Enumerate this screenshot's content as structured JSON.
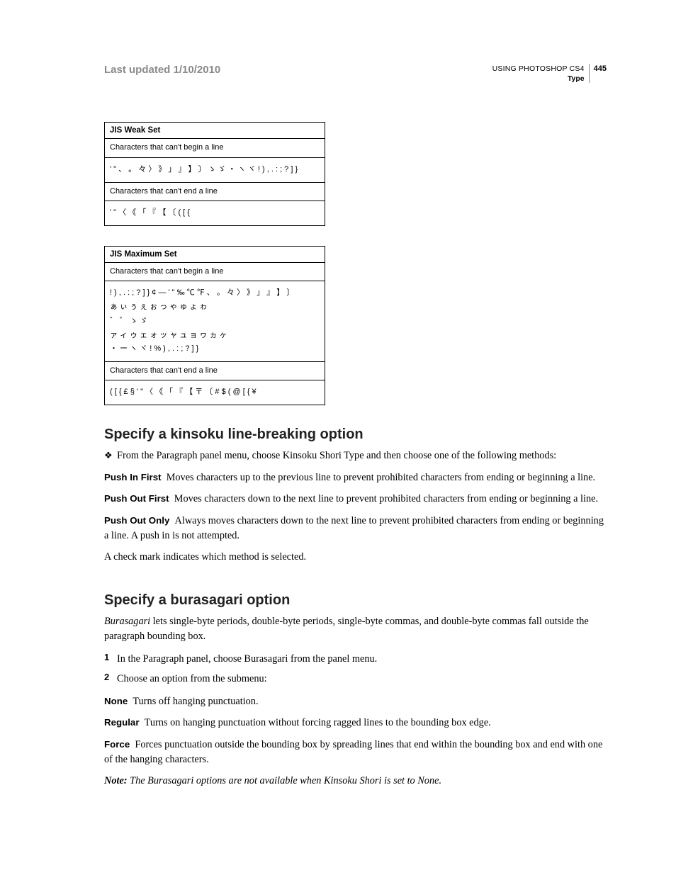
{
  "header": {
    "last_updated": "Last updated 1/10/2010",
    "doc_title": "USING PHOTOSHOP CS4",
    "section": "Type",
    "page_number": "445"
  },
  "tables": {
    "weak": {
      "title": "JIS Weak Set",
      "row1_label": "Characters that can't begin a line",
      "row1_chars": "' \" 、 。 々 〉 》 」 』 】 〕 ゝ ゞ ・ ヽ ヾ ! ) , . : ; ? ] }",
      "row2_label": "Characters that can't end a line",
      "row2_chars": "' \" 〈 《 「 『 【 〔 ( [ {"
    },
    "max": {
      "title": "JIS Maximum Set",
      "row1_label": "Characters that can't begin a line",
      "row1_chars_line1": "! ) , . : ; ? ] } ¢ — ' \" ‰ ℃ ℉ 、 。 々 〉 》 」 』 】 〕",
      "row1_chars_line2": "ぁ ぃ ぅ ぇ ぉ っ ゃ ゅ ょ ゎ",
      "row1_chars_line3": "゛ ゜ ゝ ゞ",
      "row1_chars_line4": "ァ ィ ゥ ェ ォ ッ ャ ュ ョ ヮ ヵ ヶ",
      "row1_chars_line5": "・ ー ヽ ヾ ! % ) , . : ; ? ] }",
      "row2_label": "Characters that can't end a line",
      "row2_chars": "( [ { £ § ' \" 〈 《 「 『 【 〒 〔 # $ ( @ [ { ¥"
    }
  },
  "kinsoku": {
    "heading": "Specify a kinsoku line-breaking option",
    "intro": "From the Paragraph panel menu, choose Kinsoku Shori Type and then choose one of the following methods:",
    "opts": {
      "push_in_first": {
        "label": "Push In First",
        "desc": "Moves characters up to the previous line to prevent prohibited characters from ending or beginning a line."
      },
      "push_out_first": {
        "label": "Push Out First",
        "desc": "Moves characters down to the next line to prevent prohibited characters from ending or beginning a line."
      },
      "push_out_only": {
        "label": "Push Out Only",
        "desc": "Always moves characters down to the next line to prevent prohibited characters from ending or beginning a line. A push in is not attempted."
      }
    },
    "tail": "A check mark indicates which method is selected."
  },
  "burasagari": {
    "heading": "Specify a burasagari option",
    "intro_em": "Burasagari",
    "intro_rest": " lets single-byte periods, double-byte periods, single-byte commas, and double-byte commas fall outside the paragraph bounding box.",
    "steps": {
      "s1": "In the Paragraph panel, choose Burasagari from the panel menu.",
      "s2": "Choose an option from the submenu:"
    },
    "opts": {
      "none": {
        "label": "None",
        "desc": "Turns off hanging punctuation."
      },
      "regular": {
        "label": "Regular",
        "desc": "Turns on hanging punctuation without forcing ragged lines to the bounding box edge."
      },
      "force": {
        "label": "Force",
        "desc": "Forces punctuation outside the bounding box by spreading lines that end within the bounding box and end with one of the hanging characters."
      }
    },
    "note_label": "Note:",
    "note_body": "The Burasagari options are not available when Kinsoku Shori is set to None."
  }
}
